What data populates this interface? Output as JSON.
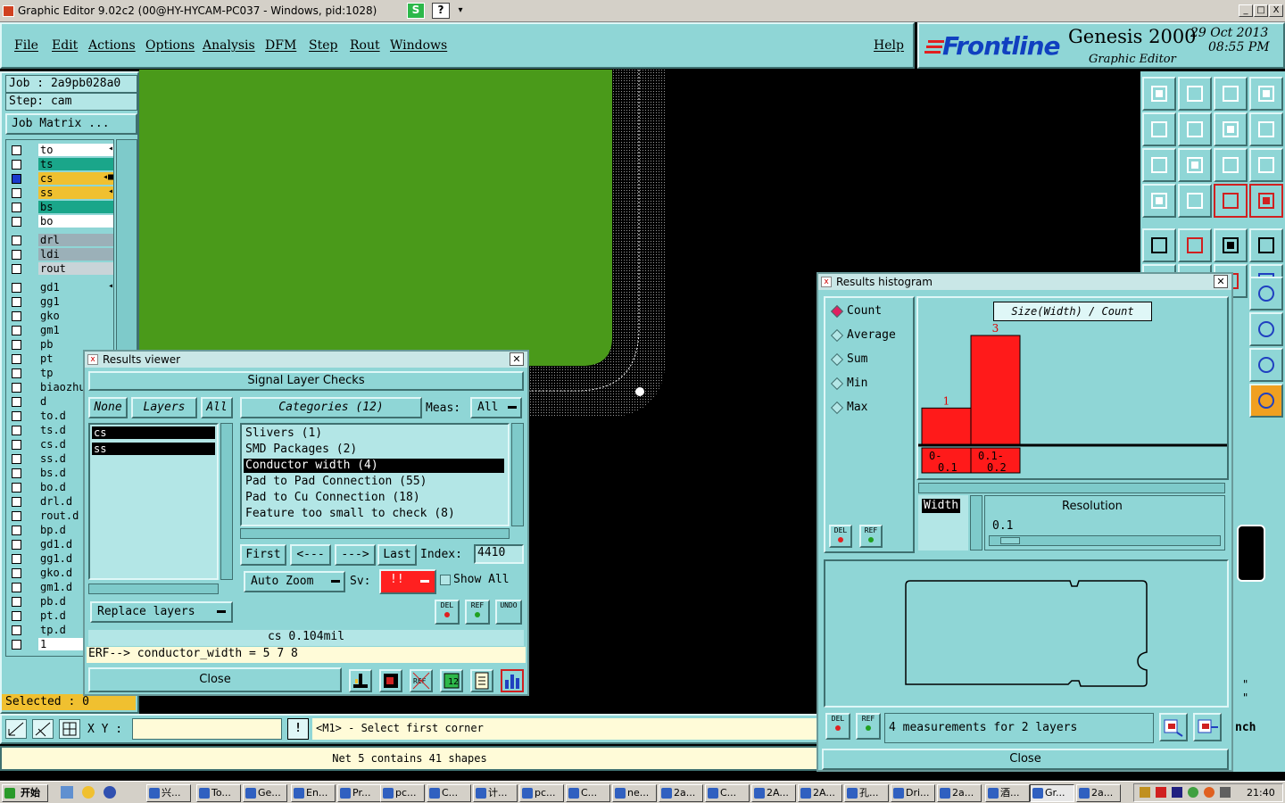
{
  "titlebar": {
    "title": "Graphic Editor 9.02c2 (00@HY-HYCAM-PC037 - Windows, pid:1028)",
    "min": "_",
    "max": "□",
    "close": "X"
  },
  "menu": {
    "items": [
      "File",
      "Edit",
      "Actions",
      "Options",
      "Analysis",
      "DFM",
      "Step",
      "Rout",
      "Windows"
    ],
    "help": "Help"
  },
  "brand": {
    "logo": "Frontline",
    "product": "Genesis 2000",
    "subtitle": "Graphic Editor",
    "date": "29 Oct 2013",
    "time": "08:55 PM"
  },
  "left": {
    "job": "Job : 2a9pb028a0",
    "step": "Step: cam",
    "job_matrix": "Job Matrix ...",
    "layers": [
      {
        "name": "to",
        "color": "#ffffff",
        "checked": false,
        "flag": "◂"
      },
      {
        "name": "ts",
        "color": "#1aa68a",
        "checked": false
      },
      {
        "name": "cs",
        "color": "#f0c030",
        "checked": true,
        "flag": "◂■"
      },
      {
        "name": "ss",
        "color": "#f0c030",
        "checked": false,
        "flag": "◂"
      },
      {
        "name": "bs",
        "color": "#1aa68a",
        "checked": false
      },
      {
        "name": "bo",
        "color": "#ffffff",
        "checked": false
      },
      {
        "name": "drl",
        "color": "#9bb0b8",
        "checked": false
      },
      {
        "name": "ldi",
        "color": "#9bb0b8",
        "checked": false
      },
      {
        "name": "rout",
        "color": "#c9d4d8",
        "checked": false
      },
      {
        "name": "gd1",
        "color": "#8fd6d6",
        "checked": false,
        "flag": "◂"
      },
      {
        "name": "gg1",
        "color": "#8fd6d6",
        "checked": false
      },
      {
        "name": "gko",
        "color": "#8fd6d6",
        "checked": false
      },
      {
        "name": "gm1",
        "color": "#8fd6d6",
        "checked": false
      },
      {
        "name": "pb",
        "color": "#8fd6d6",
        "checked": false
      },
      {
        "name": "pt",
        "color": "#8fd6d6",
        "checked": false
      },
      {
        "name": "tp",
        "color": "#8fd6d6",
        "checked": false
      },
      {
        "name": "biaozhu",
        "color": "#8fd6d6",
        "checked": false
      },
      {
        "name": "d",
        "color": "#8fd6d6",
        "checked": false
      },
      {
        "name": "to.d",
        "color": "#8fd6d6",
        "checked": false
      },
      {
        "name": "ts.d",
        "color": "#8fd6d6",
        "checked": false
      },
      {
        "name": "cs.d",
        "color": "#8fd6d6",
        "checked": false
      },
      {
        "name": "ss.d",
        "color": "#8fd6d6",
        "checked": false
      },
      {
        "name": "bs.d",
        "color": "#8fd6d6",
        "checked": false
      },
      {
        "name": "bo.d",
        "color": "#8fd6d6",
        "checked": false
      },
      {
        "name": "drl.d",
        "color": "#8fd6d6",
        "checked": false
      },
      {
        "name": "rout.d",
        "color": "#8fd6d6",
        "checked": false
      },
      {
        "name": "bp.d",
        "color": "#8fd6d6",
        "checked": false
      },
      {
        "name": "gd1.d",
        "color": "#8fd6d6",
        "checked": false
      },
      {
        "name": "gg1.d",
        "color": "#8fd6d6",
        "checked": false
      },
      {
        "name": "gko.d",
        "color": "#8fd6d6",
        "checked": false
      },
      {
        "name": "gm1.d",
        "color": "#8fd6d6",
        "checked": false
      },
      {
        "name": "pb.d",
        "color": "#8fd6d6",
        "checked": false
      },
      {
        "name": "pt.d",
        "color": "#8fd6d6",
        "checked": false
      },
      {
        "name": "tp.d",
        "color": "#8fd6d6",
        "checked": false
      },
      {
        "name": "1",
        "color": "#ffffff",
        "checked": false
      }
    ],
    "selected": "Selected : 0"
  },
  "bottom": {
    "xy_label": "X Y :",
    "prompt": "<M1> - Select first corner",
    "status": "Net 5 contains 41 shapes",
    "bang": "!"
  },
  "rv": {
    "title": "Results viewer",
    "header": "Signal Layer Checks",
    "none": "None",
    "layers": "Layers",
    "all": "All",
    "categories": "Categories (12)",
    "meas_label": "Meas:",
    "meas_value": "All",
    "layer_list": [
      "cs",
      "ss"
    ],
    "cat_list": [
      "Slivers (1)",
      "SMD Packages (2)",
      "Conductor width (4)",
      "Pad to Pad Connection (55)",
      "Pad to Cu Connection (18)",
      "Feature too small to check (8)"
    ],
    "first": "First",
    "prev": "<---",
    "next": "--->",
    "last": "Last",
    "index_label": "Index:",
    "index_value": "4410",
    "auto_zoom": "Auto Zoom",
    "sv_label": "Sv:",
    "sv_value": "!!",
    "show_all": "Show All",
    "replace_layers": "Replace layers",
    "del": "DEL",
    "ref": "REF",
    "undo": "UNDO",
    "measure": "cs 0.104mil",
    "erf": "ERF--> conductor_width = 5 7 8",
    "close": "Close"
  },
  "hist": {
    "title": "Results histogram",
    "options": [
      "Count",
      "Average",
      "Sum",
      "Min",
      "Max"
    ],
    "selected_option": "Count",
    "chart_title": "Size(Width) / Count",
    "width_label": "Width",
    "resolution_label": "Resolution",
    "resolution_value": "0.1",
    "summary": "4 measurements for 2 layers",
    "close": "Close",
    "del": "DEL",
    "ref": "REF"
  },
  "chart_data": {
    "type": "bar",
    "title": "Size(Width) / Count",
    "categories": [
      "0-\n0.1",
      "0.1-\n0.2"
    ],
    "cat_labels": [
      [
        "0-",
        "0.1"
      ],
      [
        "0.1-",
        "0.2"
      ]
    ],
    "values": [
      1,
      3
    ],
    "color": "#ff1a1a"
  },
  "taskbar": {
    "start": "开始",
    "clock": "21:40",
    "tasks": [
      "兴...",
      "To...",
      "Ge...",
      "En...",
      "Pr...",
      "pc...",
      "C...",
      "计...",
      "pc...",
      "C...",
      "ne...",
      "2a...",
      "C...",
      "2A...",
      "2A...",
      "孔...",
      "Dri...",
      "2a...",
      "酒...",
      "Gr...",
      "2a..."
    ]
  },
  "side_partial": [
    "\"",
    "\"",
    "nch"
  ]
}
